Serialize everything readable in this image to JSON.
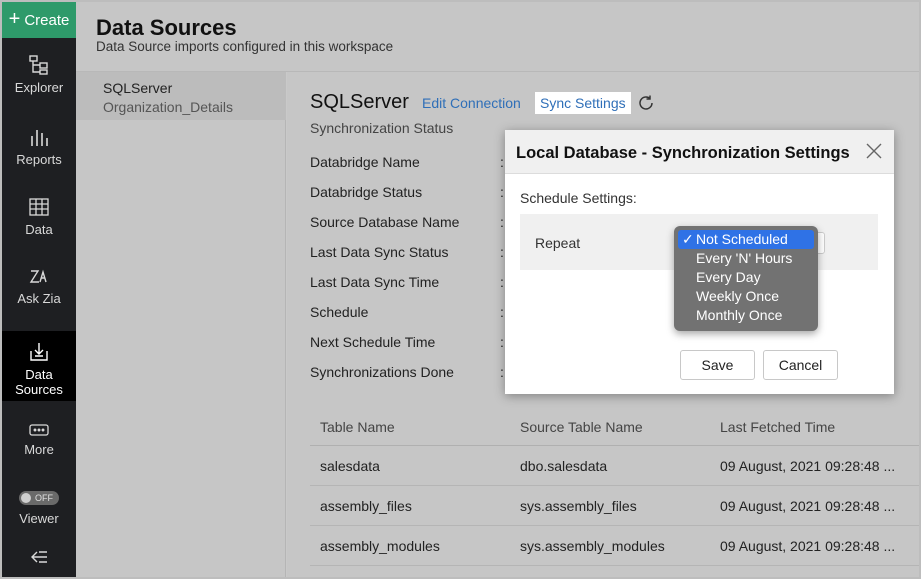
{
  "rail": {
    "create_label": "Create",
    "items": [
      {
        "label": "Explorer",
        "icon": "explorer-icon"
      },
      {
        "label": "Reports",
        "icon": "reports-icon"
      },
      {
        "label": "Data",
        "icon": "data-icon"
      },
      {
        "label": "Ask Zia",
        "icon": "ask-zia-icon"
      },
      {
        "label_line1": "Data",
        "label_line2": "Sources",
        "icon": "data-sources-icon",
        "active": true
      },
      {
        "label": "More",
        "icon": "more-icon"
      },
      {
        "label": "Viewer",
        "toggle_text": "OFF"
      }
    ],
    "collapse_icon": "collapse-left-icon"
  },
  "header": {
    "title": "Data Sources",
    "subtitle": "Data Source imports configured in this workspace"
  },
  "sources": [
    {
      "name": "SQLServer",
      "sub": "Organization_Details"
    }
  ],
  "main": {
    "title": "SQLServer",
    "edit_connection": "Edit Connection",
    "sync_settings": "Sync Settings",
    "sync_status": "Synchronization Status",
    "properties": [
      "Databridge Name",
      "Databridge Status",
      "Source Database Name",
      "Last Data Sync Status",
      "Last Data Sync Time",
      "Schedule",
      "Next Schedule Time",
      "Synchronizations Done"
    ],
    "table": {
      "headers": [
        "Table Name",
        "Source Table Name",
        "Last Fetched Time"
      ],
      "rows": [
        [
          "salesdata",
          "dbo.salesdata",
          "09 August, 2021 09:28:48 ..."
        ],
        [
          "assembly_files",
          "sys.assembly_files",
          "09 August, 2021 09:28:48 ..."
        ],
        [
          "assembly_modules",
          "sys.assembly_modules",
          "09 August, 2021 09:28:48 ..."
        ]
      ]
    }
  },
  "modal": {
    "title": "Local Database - Synchronization Settings",
    "schedule_label": "Schedule Settings:",
    "repeat_label": "Repeat",
    "options": [
      "Not Scheduled",
      "Every 'N' Hours",
      "Every Day",
      "Weekly Once",
      "Monthly Once"
    ],
    "selected_option": "Not Scheduled",
    "save": "Save",
    "cancel": "Cancel"
  },
  "colors": {
    "create_green": "#2e9a6a",
    "link_blue": "#2f6fb8",
    "selection_blue": "#2f72e6"
  }
}
